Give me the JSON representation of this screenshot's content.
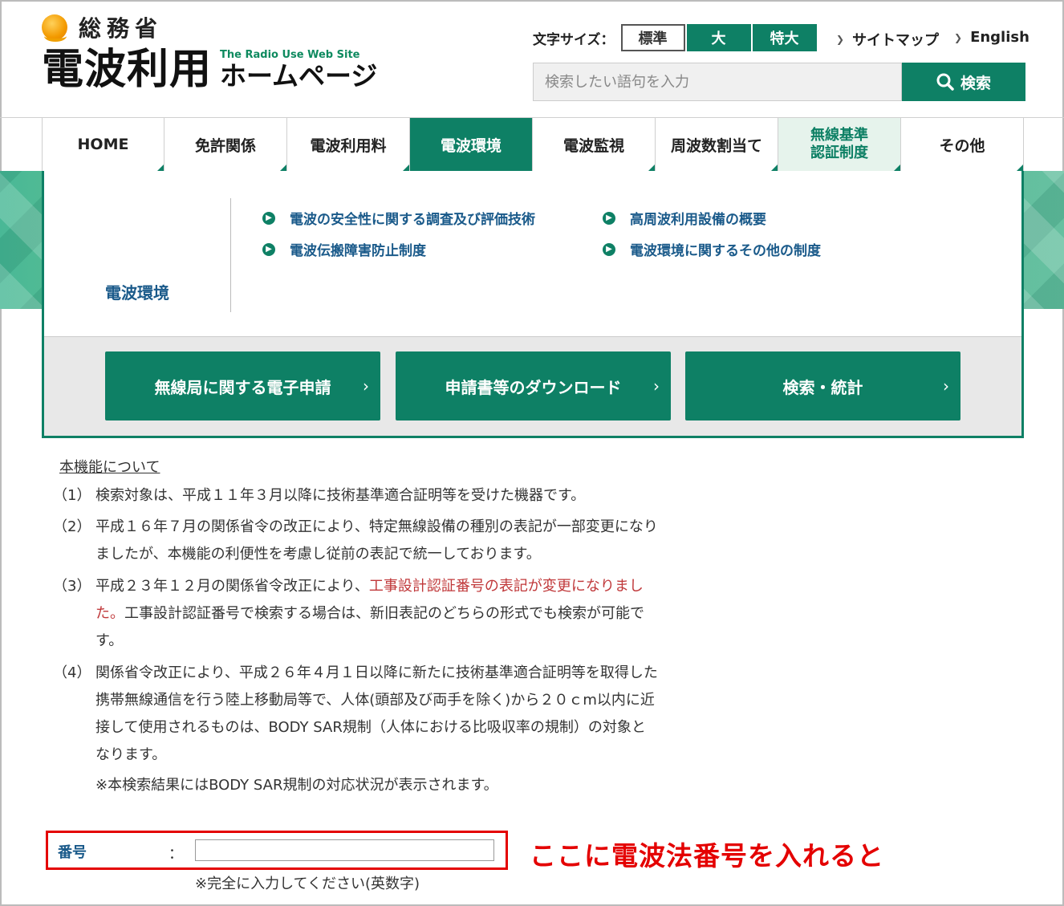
{
  "header": {
    "ministry": "総務省",
    "site_title_main": "電波利用",
    "site_title_en": "The Radio Use Web Site",
    "site_title_hp": "ホームページ",
    "font_size_label": "文字サイズ：",
    "font_sizes": [
      "標準",
      "大",
      "特大"
    ],
    "sitemap_label": "サイトマップ",
    "english_label": "English",
    "search_placeholder": "検索したい語句を入力",
    "search_button": "検索"
  },
  "nav": {
    "items": [
      "HOME",
      "免許関係",
      "電波利用料",
      "電波環境",
      "電波監視",
      "周波数割当て",
      "無線基準\n認証制度",
      "その他"
    ],
    "active_index": 3
  },
  "mega_menu": {
    "category": "電波環境",
    "links": [
      "電波の安全性に関する調査及び評価技術",
      "高周波利用設備の概要",
      "電波伝搬障害防止制度",
      "電波環境に関するその他の制度"
    ],
    "buttons": [
      "無線局に関する電子申請",
      "申請書等のダウンロード",
      "検索・統計"
    ]
  },
  "content": {
    "about_link": "本機能について",
    "items": [
      {
        "num": "（1）",
        "lines": [
          "検索対象は、平成１１年３月以降に技術基準適合証明等を受けた機器です。"
        ]
      },
      {
        "num": "（2）",
        "lines": [
          "平成１６年７月の関係省令の改正により、特定無線設備の種別の表記が一部変更になり",
          "ましたが、本機能の利便性を考慮し従前の表記で統一しております。"
        ]
      },
      {
        "num": "（3）",
        "line1_normal": "平成２３年１２月の関係省令改正により、",
        "line1_red": "工事設計認証番号の表記が変更になりまし",
        "line2_red": "た。",
        "line2_normal": "工事設計認証番号で検索する場合は、新旧表記のどちらの形式でも検索が可能で",
        "line3": "す。"
      },
      {
        "num": "（4）",
        "lines": [
          "関係省令改正により、平成２６年４月１日以降に新たに技術基準適合証明等を取得した",
          "携帯無線通信を行う陸上移動局等で、人体(頭部及び両手を除く)から２０ｃm以内に近",
          "接して使用されるものは、BODY SAR規制（人体における比吸収率の規制）の対象と",
          "なります。"
        ]
      }
    ],
    "note": "※本検索結果にはBODY SAR規制の対応状況が表示されます。"
  },
  "form": {
    "number_label": "番号",
    "colon": "：",
    "number_value": "",
    "hint": "※完全に入力してください(英数字)"
  },
  "annotation": {
    "callout": "ここに電波法番号を入れると"
  },
  "colors": {
    "brand_green": "#0e8065",
    "link_blue": "#1a5a8a",
    "highlight_red": "#e40000",
    "notice_red": "#c0383a"
  }
}
